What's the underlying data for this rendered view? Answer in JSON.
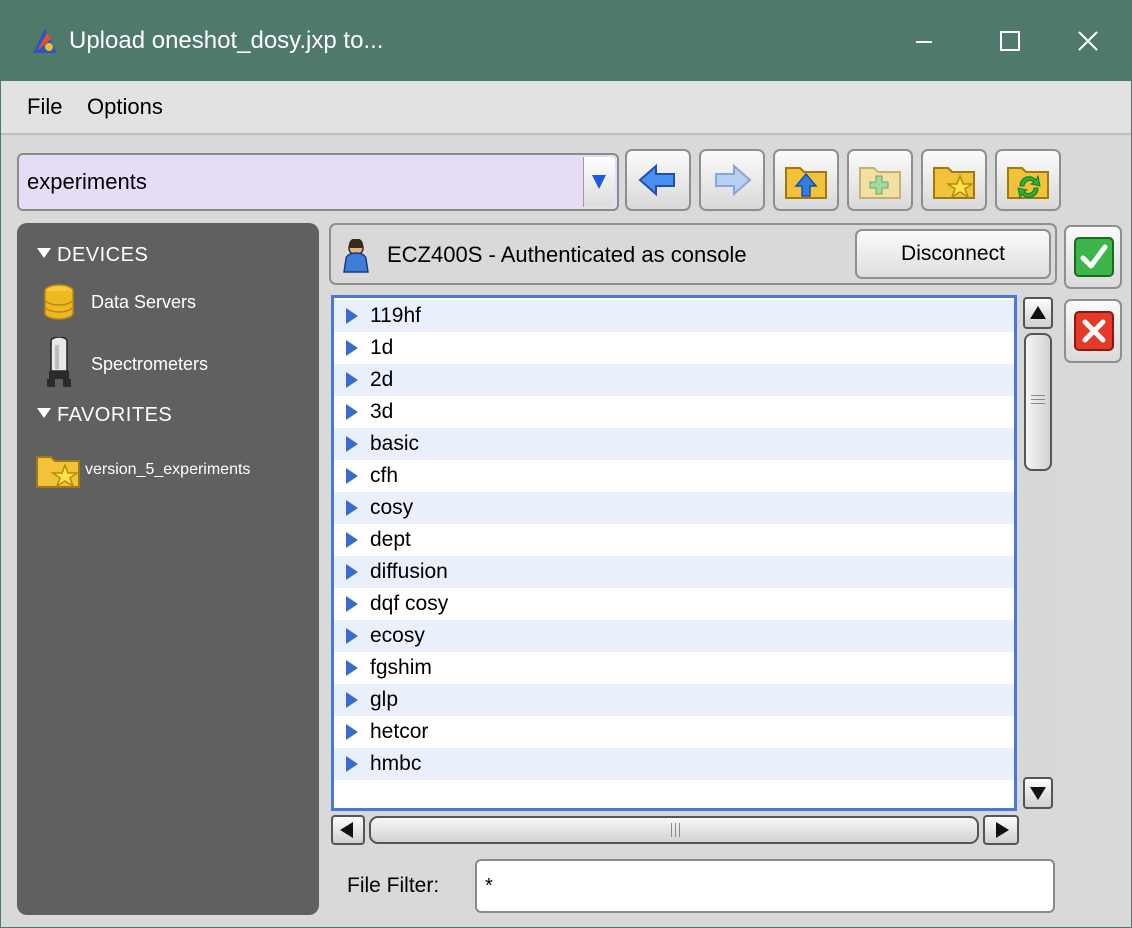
{
  "window": {
    "title": "Upload oneshot_dosy.jxp to...",
    "controls": {
      "minimize": "—",
      "maximize": "☐",
      "close": "✕"
    }
  },
  "menu": {
    "file": "File",
    "options": "Options"
  },
  "toolbar": {
    "path": "experiments",
    "buttons": [
      {
        "name": "back-arrow-icon",
        "enabled": true
      },
      {
        "name": "forward-arrow-icon",
        "enabled": false
      },
      {
        "name": "folder-up-icon",
        "enabled": true
      },
      {
        "name": "new-folder-icon",
        "enabled": false
      },
      {
        "name": "favorite-folder-icon",
        "enabled": true
      },
      {
        "name": "refresh-folder-icon",
        "enabled": true
      }
    ]
  },
  "sidebar": {
    "devices_label": "DEVICES",
    "devices": [
      {
        "label": "Data Servers",
        "icon": "database-icon"
      },
      {
        "label": "Spectrometers",
        "icon": "spectrometer-icon"
      }
    ],
    "favorites_label": "FAVORITES",
    "favorites": [
      {
        "label": "version_5_experiments",
        "icon": "favorite-folder-icon"
      }
    ]
  },
  "connection": {
    "status": "ECZ400S - Authenticated as console",
    "icon": "user-icon",
    "disconnect_label": "Disconnect"
  },
  "dialog_buttons": {
    "ok_icon": "checkmark-icon",
    "cancel_icon": "cancel-x-icon"
  },
  "files": [
    "119hf",
    "1d",
    "2d",
    "3d",
    "basic",
    "cfh",
    "cosy",
    "dept",
    "diffusion",
    "dqf cosy",
    "ecosy",
    "fgshim",
    "glp",
    "hetcor",
    "hmbc"
  ],
  "filter": {
    "label": "File Filter:",
    "value": "*"
  },
  "colors": {
    "titlebar": "#4f7a6a",
    "path_bg": "#e7dcf6",
    "list_border": "#4a78d8",
    "row_alt": "#eaf0fb",
    "arrow": "#3a6bd1",
    "sidebar": "#606060"
  }
}
